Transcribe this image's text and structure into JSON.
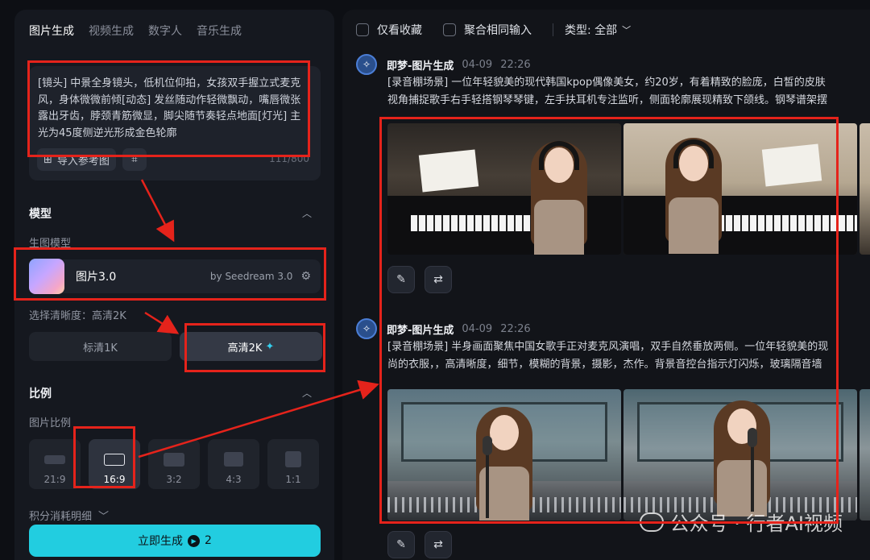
{
  "left": {
    "tabs": [
      {
        "label": "图片生成",
        "active": true
      },
      {
        "label": "视频生成",
        "active": false
      },
      {
        "label": "数字人",
        "active": false
      },
      {
        "label": "音乐生成",
        "active": false
      }
    ],
    "prompt": {
      "text": "[镜头] 中景全身镜头，低机位仰拍，女孩双手握立式麦克风，身体微微前倾[动态] 发丝随动作轻微飘动，嘴唇微张露出牙齿，脖颈青筋微显，脚尖随节奏轻点地面[灯光] 主光为45度侧逆光形成金色轮廓",
      "import_label": "导入参考图",
      "counter": "111/800"
    },
    "model_section": {
      "title": "模型",
      "sub_label": "生图模型",
      "model_name": "图片3.0",
      "model_by": "by Seedream 3.0"
    },
    "resolution": {
      "label": "选择清晰度：高清2K",
      "options": [
        {
          "label": "标清1K",
          "active": false
        },
        {
          "label": "高清2K",
          "active": true
        }
      ]
    },
    "ratio_section": {
      "title": "比例",
      "sub_label": "图片比例",
      "options": [
        {
          "label": "21:9",
          "active": false
        },
        {
          "label": "16:9",
          "active": true
        },
        {
          "label": "3:2",
          "active": false
        },
        {
          "label": "4:3",
          "active": false
        },
        {
          "label": "1:1",
          "active": false
        }
      ]
    },
    "cost_label": "积分消耗明细",
    "generate": {
      "label": "立即生成",
      "cost": "2"
    }
  },
  "right": {
    "filters": {
      "favorites_only": "仅看收藏",
      "aggregate_same": "聚合相同输入",
      "type_label": "类型: 全部"
    },
    "entries": [
      {
        "author": "即梦-图片生成",
        "date": "04-09",
        "time": "22:26",
        "desc_line1": "[录音棚场景] 一位年轻貌美的现代韩国kpop偶像美女，约20岁，有着精致的脸庞，白皙的皮肤",
        "desc_line2": "视角捕捉歌手右手轻搭钢琴琴键，左手扶耳机专注监听，侧面轮廓展现精致下颌线。钢琴谱架摆"
      },
      {
        "author": "即梦-图片生成",
        "date": "04-09",
        "time": "22:26",
        "desc_line1": "[录音棚场景] 半身画面聚焦中国女歌手正对麦克风演唱，双手自然垂放两侧。一位年轻貌美的现",
        "desc_line2": "尚的衣服，，高清晰度，细节，模糊的背景，摄影，杰作。背景音控台指示灯闪烁，玻璃隔音墙"
      }
    ]
  },
  "watermark": "公众号 · 行者AI视频",
  "colors": {
    "accent": "#22cde0",
    "annotation": "#e5231b",
    "panel": "#15181f",
    "background": "#0d0f14"
  }
}
